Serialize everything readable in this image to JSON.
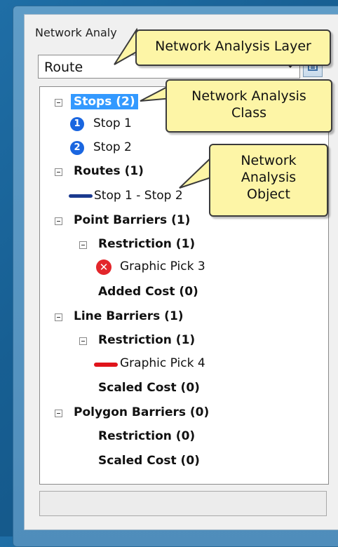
{
  "window": {
    "title": "Network Analy"
  },
  "layer_select": {
    "value": "Route"
  },
  "tree": {
    "stops": {
      "label": "Stops (2)",
      "items": [
        "Stop 1",
        "Stop 2"
      ],
      "icons": [
        "1",
        "2"
      ]
    },
    "routes": {
      "label": "Routes (1)",
      "items": [
        "Stop 1 - Stop 2"
      ]
    },
    "point_barriers": {
      "label": "Point Barriers (1)",
      "restriction": "Restriction (1)",
      "restriction_items": [
        "Graphic Pick 3"
      ],
      "added_cost": "Added Cost (0)"
    },
    "line_barriers": {
      "label": "Line Barriers (1)",
      "restriction": "Restriction (1)",
      "restriction_items": [
        "Graphic Pick 4"
      ],
      "scaled_cost": "Scaled Cost (0)"
    },
    "polygon_barriers": {
      "label": "Polygon Barriers (0)",
      "restriction": "Restriction (0)",
      "scaled_cost": "Scaled Cost (0)"
    }
  },
  "callouts": {
    "layer": "Network Analysis Layer",
    "class_line1": "Network Analysis",
    "class_line2": "Class",
    "object_line1": "Network",
    "object_line2": "Analysis",
    "object_line3": "Object"
  },
  "colors": {
    "selection": "#3399ff",
    "stop_icon": "#1a66e0",
    "route_line": "#1b3a8f",
    "barrier_red": "#e0141b",
    "callout_fill": "#fdf5a6"
  }
}
